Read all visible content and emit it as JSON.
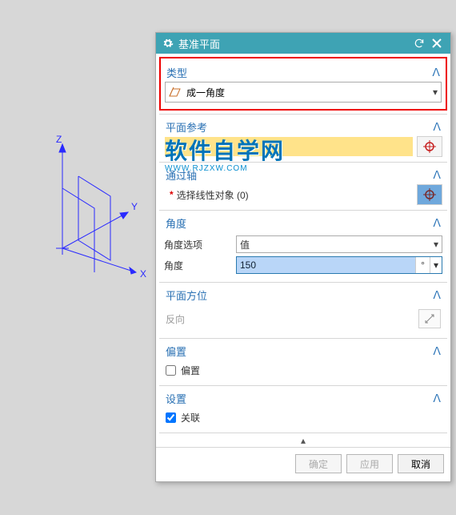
{
  "coord": {
    "axes": [
      "X",
      "Y",
      "Z"
    ]
  },
  "dialog": {
    "title": "基准平面",
    "type": {
      "header": "类型",
      "value": "成一角度"
    },
    "planeRef": {
      "header": "平面参考"
    },
    "axis": {
      "header": "通过轴",
      "label": "选择线性对象 (0)"
    },
    "angle": {
      "header": "角度",
      "optionLabel": "角度选项",
      "optionValue": "值",
      "valueLabel": "角度",
      "value": "150",
      "unit": "°"
    },
    "orient": {
      "header": "平面方位",
      "reverse": "反向"
    },
    "offset": {
      "header": "偏置",
      "check": "偏置"
    },
    "settings": {
      "header": "设置",
      "assoc": "关联"
    },
    "buttons": {
      "ok": "确定",
      "apply": "应用",
      "cancel": "取消"
    }
  },
  "watermark": {
    "big": "软件自学网",
    "small": "WWW.RJZXW.COM"
  }
}
